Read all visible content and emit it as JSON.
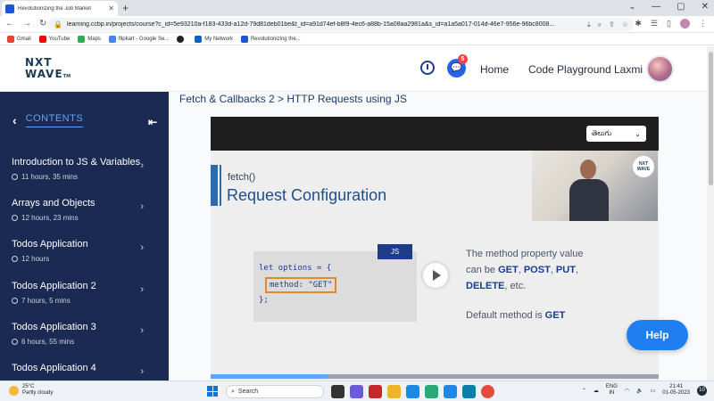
{
  "browser": {
    "tab_title": "Revolutionizing the Job Market",
    "url": "learning.ccbp.in/projects/course?c_id=5e93210a-f183-433d-a12d-79d81deb01be&t_id=a91d74ef-b8f9-4ec6-a88b-15a08aa2981a&s_id=a1a5a017-014d-46e7-956e-96bc8008...",
    "bookmarks": [
      {
        "label": "Gmail",
        "color": "#ea4335"
      },
      {
        "label": "YouTube",
        "color": "#ff0000"
      },
      {
        "label": "Maps",
        "color": "#34a853"
      },
      {
        "label": "flipkart - Google Se...",
        "color": "#4285f4"
      },
      {
        "label": "",
        "color": "#202124"
      },
      {
        "label": "My Network",
        "color": "#0a66c2"
      },
      {
        "label": "Revolutionizing the...",
        "color": "#1a56db"
      }
    ]
  },
  "header": {
    "logo_line1": "NXT",
    "logo_line2": "WAVE",
    "logo_tm": "TM",
    "notification_count": "5",
    "nav_home": "Home",
    "nav_playground": "Code Playground",
    "user_name": "Laxmi"
  },
  "sidebar": {
    "title": "CONTENTS",
    "courses": [
      {
        "name": "Introduction to JS & Variables",
        "duration": "11 hours, 35 mins"
      },
      {
        "name": "Arrays and Objects",
        "duration": "12 hours, 23 mins"
      },
      {
        "name": "Todos Application",
        "duration": "12 hours"
      },
      {
        "name": "Todos Application 2",
        "duration": "7 hours, 5 mins"
      },
      {
        "name": "Todos Application 3",
        "duration": "6 hours, 55 mins"
      },
      {
        "name": "Todos Application 4",
        "duration": ""
      }
    ]
  },
  "main": {
    "breadcrumb": "Fetch & Callbacks 2 > HTTP Requests using JS",
    "language": "తెలుగు",
    "slide_kicker": "fetch()",
    "slide_title": "Request Configuration",
    "js_tag": "JS",
    "code_line1": "let options = {",
    "code_line2": "method: \"GET\"",
    "code_line3": "};",
    "para_lead": "The method property value can be",
    "method_get": "GET",
    "method_post": "POST",
    "method_put": "PUT",
    "method_delete": "DELETE",
    "para_tail": ", etc.",
    "default_lead": "Default method is",
    "default_value": "GET",
    "webcam_logo": "NXT WAVE",
    "progress": 0.26
  },
  "help_label": "Help",
  "taskbar": {
    "temperature": "25°C",
    "weather": "Partly cloudy",
    "search": "Search",
    "lang1": "ENG",
    "lang2": "IN",
    "time": "21:41",
    "date": "01-05-2023",
    "notif": "10"
  }
}
